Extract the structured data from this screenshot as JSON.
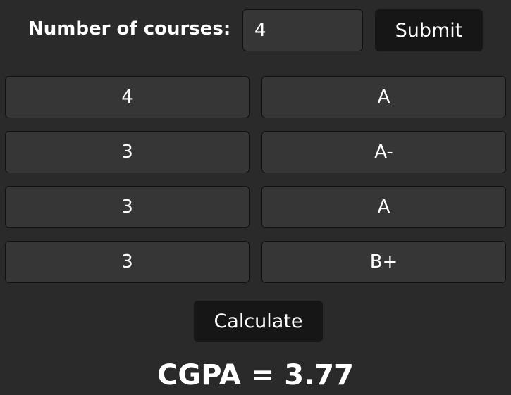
{
  "form": {
    "count_label": "Number of courses:",
    "count_value": "4",
    "submit_label": "Submit"
  },
  "courses": [
    {
      "credits": "4",
      "grade": "A"
    },
    {
      "credits": "3",
      "grade": "A-"
    },
    {
      "credits": "3",
      "grade": "A"
    },
    {
      "credits": "3",
      "grade": "B+"
    }
  ],
  "calculate_label": "Calculate",
  "result": {
    "text": "CGPA = 3.77"
  }
}
